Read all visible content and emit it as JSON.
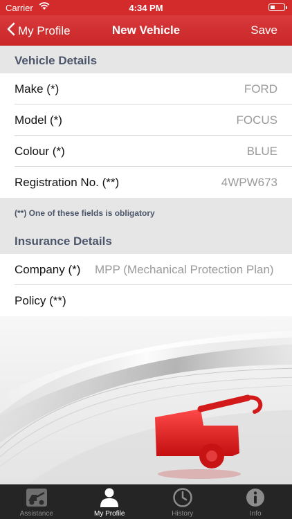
{
  "status_bar": {
    "carrier": "Carrier",
    "time": "4:34 PM",
    "battery_level": 0.35
  },
  "nav": {
    "back_label": "My Profile",
    "title": "New Vehicle",
    "save_label": "Save"
  },
  "vehicle_section": {
    "title": "Vehicle Details",
    "rows": [
      {
        "label": "Make (*)",
        "value": "FORD"
      },
      {
        "label": "Model (*)",
        "value": "FOCUS"
      },
      {
        "label": "Colour (*)",
        "value": "BLUE"
      },
      {
        "label": "Registration No. (**)",
        "value": "4WPW673"
      }
    ],
    "note": "(**) One of these fields is obligatory"
  },
  "insurance_section": {
    "title": "Insurance Details",
    "rows": [
      {
        "label": "Company (*)",
        "value": "MPP (Mechanical Protection Plan)"
      },
      {
        "label": "Policy (**)",
        "value": ""
      }
    ]
  },
  "tabs": [
    {
      "label": "Assistance",
      "icon": "tow-truck-icon",
      "active": false
    },
    {
      "label": "My Profile",
      "icon": "person-icon",
      "active": true
    },
    {
      "label": "History",
      "icon": "clock-icon",
      "active": false
    },
    {
      "label": "Info",
      "icon": "info-icon",
      "active": false
    }
  ],
  "colors": {
    "brand_red": "#d32a2c",
    "section_bg": "#e6e6e6",
    "tabbar_bg": "#252525"
  }
}
